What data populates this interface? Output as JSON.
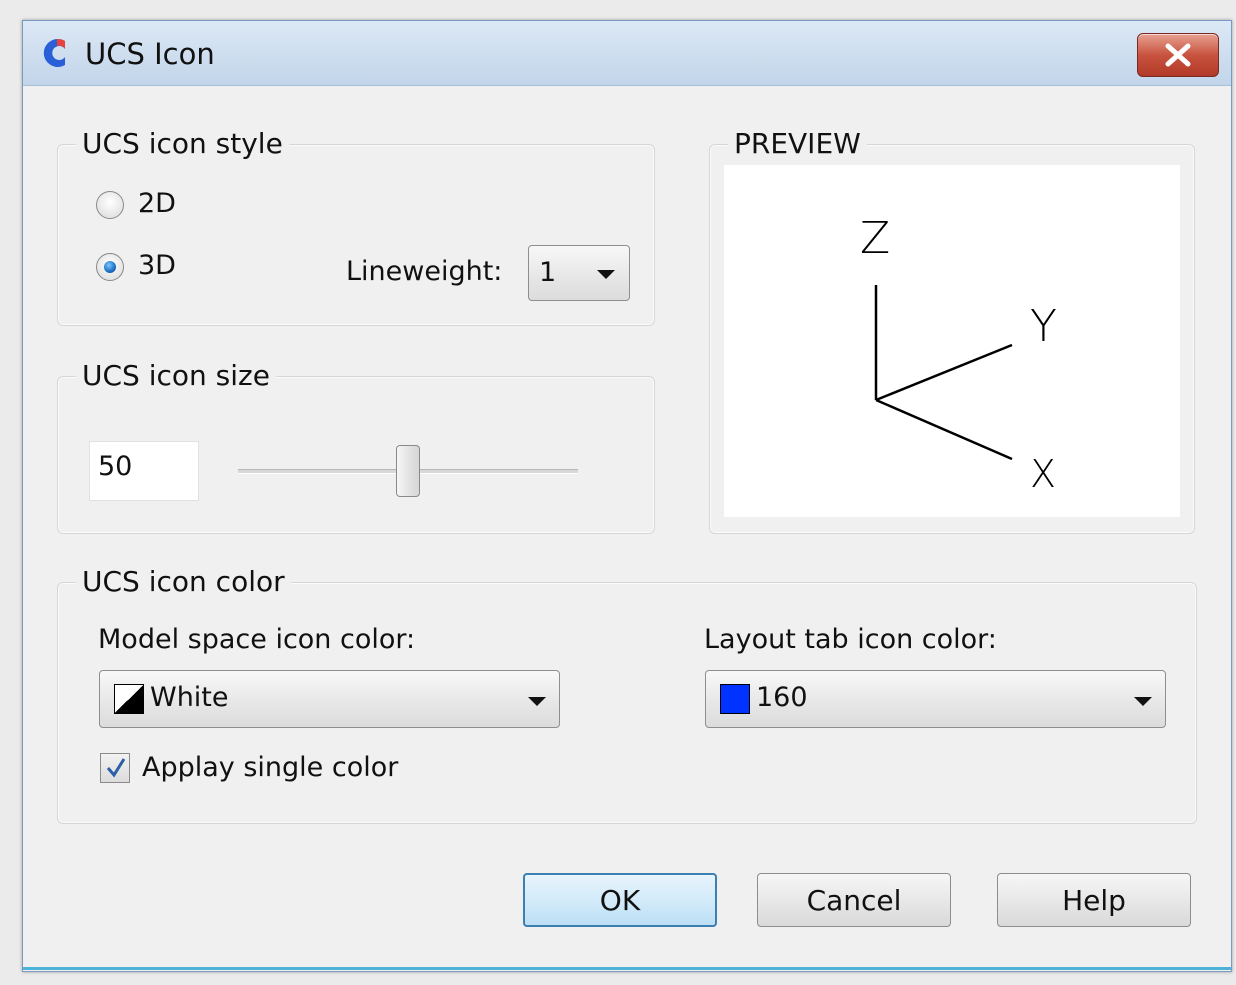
{
  "window": {
    "title": "UCS Icon"
  },
  "style_group": {
    "legend": "UCS icon style",
    "options": [
      {
        "label": "2D",
        "checked": false
      },
      {
        "label": "3D",
        "checked": true
      }
    ],
    "lineweight_label": "Lineweight:",
    "lineweight_value": "1"
  },
  "preview": {
    "legend": "PREVIEW",
    "axes": {
      "z": "Z",
      "y": "Y",
      "x": "X"
    }
  },
  "size_group": {
    "legend": "UCS icon size",
    "value": "50",
    "slider_fraction": 0.5
  },
  "color_group": {
    "legend": "UCS icon color",
    "model_label": "Model space icon color:",
    "model_value": "White",
    "layout_label": "Layout tab icon color:",
    "layout_value": "160",
    "layout_swatch": "#0033ff",
    "single_color_label": "Applay single color",
    "single_color_checked": true
  },
  "buttons": {
    "ok": "OK",
    "cancel": "Cancel",
    "help": "Help"
  },
  "colors": {
    "accent": "#4db2d8",
    "close": "#c8533f"
  }
}
